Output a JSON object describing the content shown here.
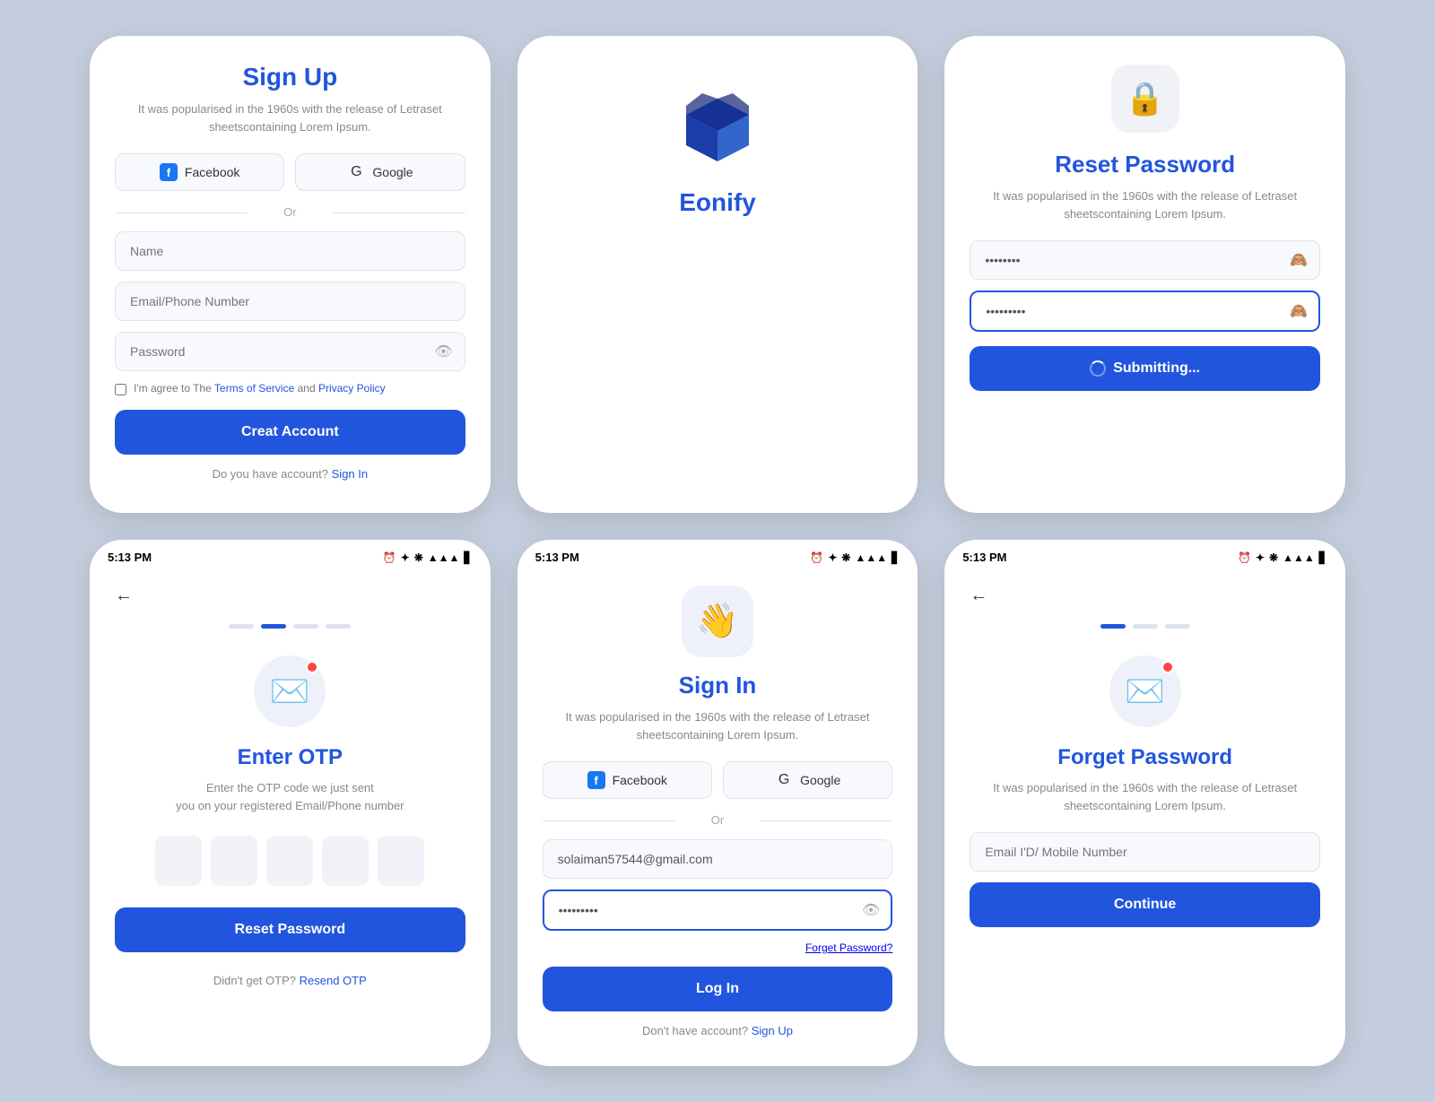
{
  "background": "#c5cede",
  "cards": {
    "signup": {
      "title": "Sign Up",
      "subtitle": "It was popularised in the 1960s with the release of Letraset sheetscontaining Lorem Ipsum.",
      "facebook_label": "Facebook",
      "google_label": "Google",
      "or_label": "Or",
      "name_placeholder": "Name",
      "email_placeholder": "Email/Phone Number",
      "password_placeholder": "Password",
      "terms_text": "I'm agree to The ",
      "terms_link": "Terms of Service",
      "terms_and": " and ",
      "privacy_link": "Privacy Policy",
      "create_btn": "Creat Account",
      "signin_prompt": "Do you have account?",
      "signin_link": "Sign In"
    },
    "eonify": {
      "title": "Eonify"
    },
    "reset_password": {
      "title": "Reset Password",
      "subtitle": "It was popularised in the 1960s with the release of Letraset sheetscontaining Lorem Ipsum.",
      "password_dots": "••••••••",
      "password_dots2": "••••••••|",
      "submit_btn": "Submitting...",
      "icon": "🔒"
    },
    "enter_otp": {
      "title": "Enter OTP",
      "desc_line1": "Enter the OTP code we just sent",
      "desc_line2": "you on your registered Email/Phone number",
      "reset_btn": "Reset Password",
      "resend_prompt": "Didn't get OTP?",
      "resend_link": "Resend OTP",
      "statusbar_time": "5:13 PM",
      "back_arrow": "←",
      "dots": [
        "inactive",
        "active",
        "inactive",
        "inactive"
      ]
    },
    "signin": {
      "title": "Sign In",
      "subtitle": "It was popularised in the 1960s with the release of Letraset sheetscontaining Lorem Ipsum.",
      "facebook_label": "Facebook",
      "google_label": "Google",
      "or_label": "Or",
      "email_value": "solaiman57544@gmail.com",
      "password_dots": "••••••••|",
      "forgot_label": "Forget Password?",
      "login_btn": "Log In",
      "register_prompt": "Don't have account?",
      "register_link": "Sign Up",
      "statusbar_time": "5:13 PM",
      "hand_icon": "👋"
    },
    "forget_password": {
      "title": "Forget Password",
      "subtitle": "It was popularised in the 1960s with the release of Letraset sheetscontaining Lorem Ipsum.",
      "email_placeholder": "Email I'D/ Mobile Number",
      "continue_btn": "Continue",
      "statusbar_time": "5:13 PM",
      "back_arrow": "←",
      "dots": [
        "active",
        "inactive",
        "inactive"
      ]
    }
  },
  "statusbar": {
    "time": "5:13 PM",
    "icons": "⏰ ✦ ❋ ▲▲▲ 🔋"
  }
}
